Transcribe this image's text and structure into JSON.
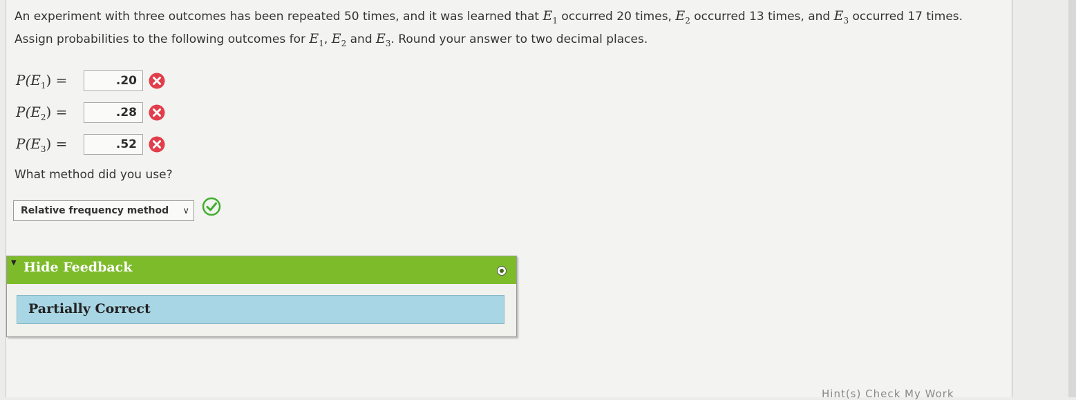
{
  "question": {
    "part1": "An experiment with three outcomes has been repeated 50 times, and it was learned that ",
    "e1": "E",
    "sub1": "1",
    "part2": " occurred 20 times, ",
    "e2": "E",
    "sub2": "2",
    "part3": " occurred 13 times, and ",
    "e3": "E",
    "sub3": "3",
    "part4": " occurred 17 times. Assign probabilities to the following outcomes for ",
    "part5": ", ",
    "part6": " and ",
    "part7": ". Round your answer to two decimal places."
  },
  "answers": [
    {
      "label_pre": "P(E",
      "label_sub": "1",
      "label_post": ") =",
      "value": ".20",
      "status_icon": "x-circle-icon"
    },
    {
      "label_pre": "P(E",
      "label_sub": "2",
      "label_post": ") =",
      "value": ".28",
      "status_icon": "x-circle-icon"
    },
    {
      "label_pre": "P(E",
      "label_sub": "3",
      "label_post": ") =",
      "value": ".52",
      "status_icon": "x-circle-icon"
    }
  ],
  "method": {
    "question": "What method did you use?",
    "selected": "Relative frequency method",
    "status_icon": "check-circle-icon"
  },
  "feedback": {
    "toggle_label": "Hide Feedback",
    "status": "Partially Correct"
  },
  "footer": {
    "partial_text": "Hint(s)   Check My Work"
  },
  "colors": {
    "wrong": "#e23d4b",
    "correct": "#3fae2a",
    "feedback_header": "#7dbb2b",
    "feedback_body": "#a9d6e4"
  }
}
